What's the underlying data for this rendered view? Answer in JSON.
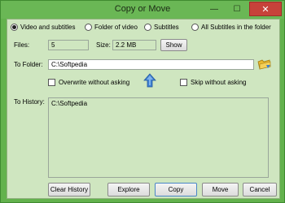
{
  "window": {
    "title": "Copy or Move",
    "minimize_glyph": "—",
    "maximize_glyph": "☐",
    "close_glyph": "✕"
  },
  "source_options": {
    "items": [
      {
        "label": "Video and subtitles",
        "selected": true
      },
      {
        "label": "Folder of video",
        "selected": false
      },
      {
        "label": "Subtitles",
        "selected": false
      },
      {
        "label": "All Subtitles in the folder",
        "selected": false
      }
    ]
  },
  "files": {
    "label": "Files:",
    "value": "5"
  },
  "size": {
    "label": "Size:",
    "value": "2.2 MB"
  },
  "show_button": "Show",
  "to_folder": {
    "label": "To Folder:",
    "value": "C:\\Softpedia"
  },
  "overwrite": {
    "label": "Overwrite without asking",
    "checked": false
  },
  "skip": {
    "label": "Skip without asking",
    "checked": false
  },
  "history": {
    "label": "To History:",
    "items": [
      "C:\\Softpedia"
    ]
  },
  "buttons": {
    "clear_history": "Clear History",
    "explore": "Explore",
    "copy": "Copy",
    "move": "Move",
    "cancel": "Cancel"
  },
  "colors": {
    "frame": "#63b24d",
    "client": "#cfe6c0",
    "close": "#c7423a",
    "arrow": "#3d7fd0"
  },
  "icons": [
    "folder-browse-icon",
    "up-arrow-icon"
  ]
}
